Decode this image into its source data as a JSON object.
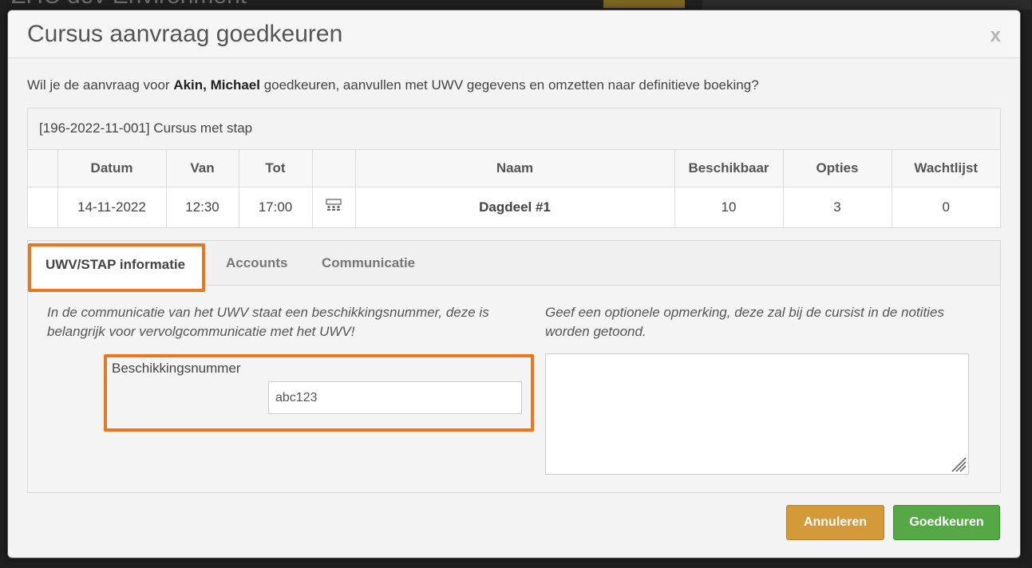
{
  "background": {
    "title_fragment": "ZHC dev Environment"
  },
  "modal": {
    "title": "Cursus aanvraag goedkeuren",
    "close_label": "x",
    "intro_before": "Wil je de aanvraag voor ",
    "intro_name": "Akin, Michael",
    "intro_after": " goedkeuren, aanvullen met UWV gegevens en omzetten naar definitieve boeking?"
  },
  "course": {
    "heading": "[196-2022-11-001] Cursus met stap",
    "columns": [
      "",
      "Datum",
      "Van",
      "Tot",
      "",
      "Naam",
      "Beschikbaar",
      "Opties",
      "Wachtlijst"
    ],
    "rows": [
      {
        "datum": "14-11-2022",
        "van": "12:30",
        "tot": "17:00",
        "icon": "classroom-icon",
        "naam": "Dagdeel #1",
        "beschikbaar": "10",
        "opties": "3",
        "wachtlijst": "0"
      }
    ]
  },
  "tabs": [
    {
      "label": "UWV/STAP informatie",
      "active": true
    },
    {
      "label": "Accounts",
      "active": false
    },
    {
      "label": "Communicatie",
      "active": false
    }
  ],
  "uwv": {
    "info_left": "In de communicatie van het UWV staat een beschikkingsnummer, deze is belangrijk voor vervolgcommunicatie met het UWV!",
    "info_right": "Geef een optionele opmerking, deze zal bij de cursist in de notities worden getoond.",
    "field_label": "Beschikkingsnummer",
    "field_value": "abc123",
    "remark_value": ""
  },
  "buttons": {
    "cancel": "Annuleren",
    "approve": "Goedkeuren"
  },
  "colors": {
    "highlight": "#e87722",
    "cancel": "#d49a3a",
    "approve": "#56a847"
  }
}
